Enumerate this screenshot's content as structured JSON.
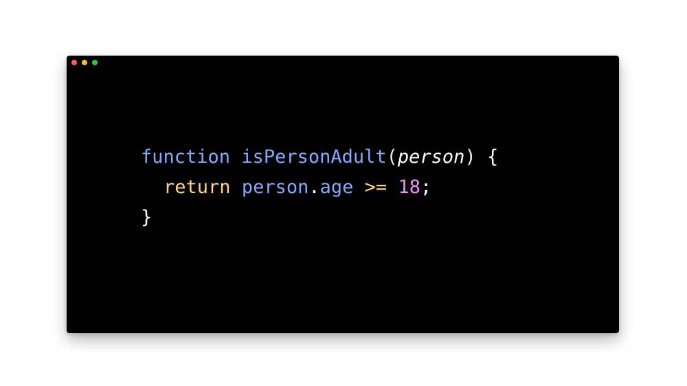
{
  "window": {
    "background": "#000000",
    "controls": [
      {
        "name": "close",
        "color": "#ff5f57"
      },
      {
        "name": "minimize",
        "color": "#febc2e"
      },
      {
        "name": "zoom",
        "color": "#28c840"
      }
    ]
  },
  "code": {
    "lines": [
      [
        {
          "text": "function",
          "color": "#82aaff"
        },
        {
          "text": " ",
          "color": "#ffffff"
        },
        {
          "text": "isPersonAdult",
          "color": "#82aaff"
        },
        {
          "text": "(",
          "color": "#d9f5dd"
        },
        {
          "text": "person",
          "color": "#ffffff",
          "italic": true
        },
        {
          "text": ")",
          "color": "#d9f5dd"
        },
        {
          "text": " ",
          "color": "#ffffff"
        },
        {
          "text": "{",
          "color": "#ffffff"
        }
      ],
      [
        {
          "text": "return",
          "color": "#ffd580"
        },
        {
          "text": " ",
          "color": "#ffffff"
        },
        {
          "text": "person",
          "color": "#82aaff"
        },
        {
          "text": ".",
          "color": "#ffffff"
        },
        {
          "text": "age",
          "color": "#82aaff"
        },
        {
          "text": " ",
          "color": "#ffffff"
        },
        {
          "text": ">=",
          "color": "#ffd580"
        },
        {
          "text": " ",
          "color": "#ffffff"
        },
        {
          "text": "18",
          "color": "#f78cfc"
        },
        {
          "text": ";",
          "color": "#ffffff"
        }
      ],
      [
        {
          "text": "}",
          "color": "#ffffff"
        }
      ]
    ]
  }
}
